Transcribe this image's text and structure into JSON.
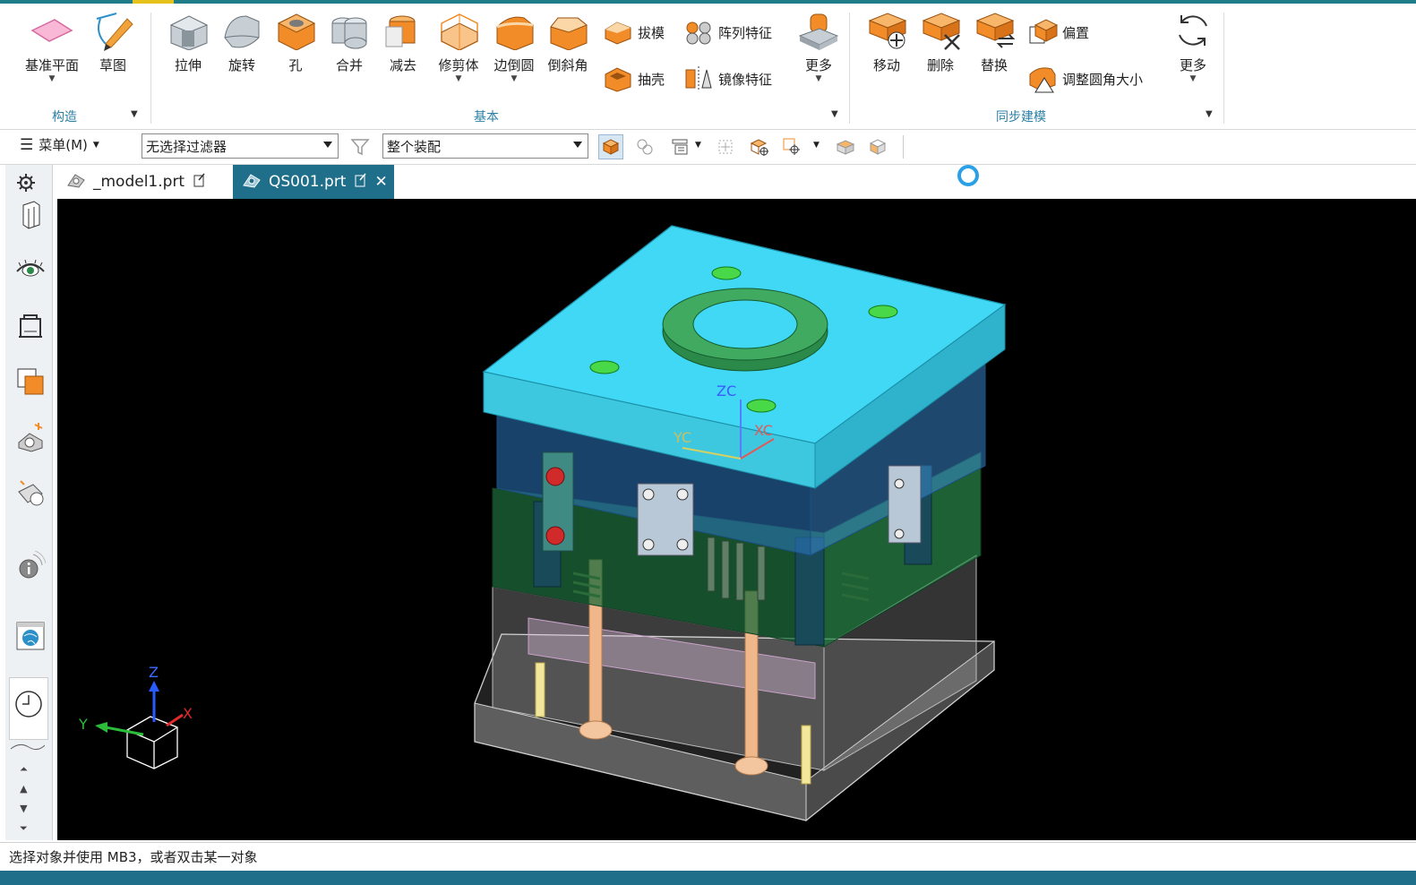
{
  "ribbon": {
    "construct": {
      "datum_plane": "基准平面",
      "sketch": "草图",
      "group_label": "构造"
    },
    "basic": {
      "extrude": "拉伸",
      "revolve": "旋转",
      "hole": "孔",
      "unite": "合并",
      "subtract": "减去",
      "trim_body": "修剪体",
      "edge_blend": "边倒圆",
      "chamfer": "倒斜角",
      "draft": "拔模",
      "shell": "抽壳",
      "pattern_feature": "阵列特征",
      "mirror_feature": "镜像特征",
      "more": "更多",
      "group_label": "基本"
    },
    "sync": {
      "move": "移动",
      "delete": "删除",
      "replace": "替换",
      "offset": "偏置",
      "resize_blend": "调整圆角大小",
      "more": "更多",
      "group_label": "同步建模"
    }
  },
  "toolbar": {
    "menu_label": "菜单(M)",
    "filter_value": "无选择过滤器",
    "scope_value": "整个装配"
  },
  "tabs": [
    {
      "label": "_model1.prt"
    },
    {
      "label": "QS001.prt"
    }
  ],
  "viewport": {
    "wcs": {
      "zc": "ZC",
      "xc": "XC",
      "yc": "YC"
    },
    "triad": {
      "z": "Z",
      "y": "Y",
      "x": "X"
    }
  },
  "status": {
    "message": "选择对象并使用 MB3，或者双击某一对象"
  },
  "colors": {
    "accent": "#1f6f8b",
    "ribbon_group_label": "#2b7fa5",
    "feature_orange": "#f28c28",
    "viewport_bg": "#000000",
    "plate_cyan": "#3fd6f0"
  },
  "icons": [
    "datum-plane-icon",
    "sketch-icon",
    "extrude-icon",
    "revolve-icon",
    "hole-icon",
    "unite-icon",
    "subtract-icon",
    "trim-body-icon",
    "edge-blend-icon",
    "chamfer-icon",
    "draft-icon",
    "shell-icon",
    "pattern-feature-icon",
    "mirror-feature-icon",
    "move-face-icon",
    "delete-face-icon",
    "replace-face-icon",
    "offset-face-icon",
    "resize-blend-icon",
    "refresh-icon",
    "gear-icon",
    "eye-icon",
    "info-icon",
    "clock-icon"
  ]
}
